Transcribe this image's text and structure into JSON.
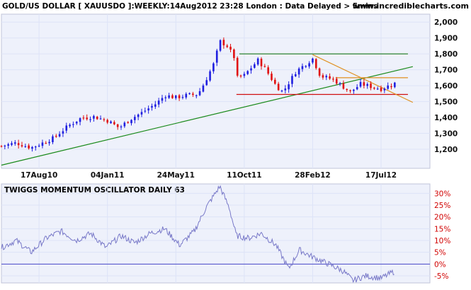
{
  "header": {
    "title": "GOLD/US DOLLAR [ XAUUSDO ]:WEEKLY:14Aug2012 23:28 London : Data Delayed > 5mins",
    "site": "www.incrediblecharts.com"
  },
  "colors": {
    "up_candle": "#1f1fe0",
    "down_candle": "#e01010",
    "support_trend": "#1a8a1a",
    "resistance_line": "#1a7a1a",
    "red_support": "#d01010",
    "orange_line": "#e09020",
    "oscillator_line": "#7878c8",
    "zero_line": "#4848c8",
    "grid": "#dde3f7",
    "background": "#eef1fb"
  },
  "chart_data": [
    {
      "type": "candlestick",
      "title": "",
      "xlabel": "",
      "ylabel": "",
      "x_ticks": [
        "17Aug10",
        "04Jan11",
        "24May11",
        "11Oct11",
        "28Feb12",
        "17Jul12"
      ],
      "y_ticks": [
        "1,200",
        "1,300",
        "1,400",
        "1,500",
        "1,600",
        "1,700",
        "1,800",
        "1,900",
        "2,000"
      ],
      "ylim": [
        1080,
        2050
      ],
      "grid": true,
      "close_points": [
        [
          "2010-06-01",
          1220
        ],
        [
          "2010-07-01",
          1240
        ],
        [
          "2010-08-01",
          1210
        ],
        [
          "2010-08-17",
          1230
        ],
        [
          "2010-09-15",
          1270
        ],
        [
          "2010-10-15",
          1345
        ],
        [
          "2010-11-10",
          1395
        ],
        [
          "2010-12-07",
          1405
        ],
        [
          "2011-01-04",
          1380
        ],
        [
          "2011-01-28",
          1335
        ],
        [
          "2011-02-20",
          1390
        ],
        [
          "2011-03-15",
          1430
        ],
        [
          "2011-04-15",
          1490
        ],
        [
          "2011-05-02",
          1540
        ],
        [
          "2011-05-24",
          1525
        ],
        [
          "2011-06-15",
          1540
        ],
        [
          "2011-07-08",
          1545
        ],
        [
          "2011-07-22",
          1620
        ],
        [
          "2011-08-10",
          1740
        ],
        [
          "2011-08-22",
          1880
        ],
        [
          "2011-09-06",
          1850
        ],
        [
          "2011-09-20",
          1780
        ],
        [
          "2011-09-27",
          1650
        ],
        [
          "2011-10-11",
          1665
        ],
        [
          "2011-11-08",
          1760
        ],
        [
          "2011-11-22",
          1710
        ],
        [
          "2011-12-15",
          1600
        ],
        [
          "2011-12-29",
          1560
        ],
        [
          "2012-01-25",
          1690
        ],
        [
          "2012-02-28",
          1770
        ],
        [
          "2012-03-15",
          1660
        ],
        [
          "2012-04-10",
          1640
        ],
        [
          "2012-05-15",
          1560
        ],
        [
          "2012-06-05",
          1610
        ],
        [
          "2012-07-17",
          1580
        ],
        [
          "2012-08-14",
          1615
        ]
      ],
      "annotations": [
        {
          "type": "trendline",
          "color": "support_trend",
          "from": [
            "2010-06-01",
            1100
          ],
          "to": [
            "2012-09-20",
            1720
          ]
        },
        {
          "type": "horizontal",
          "color": "resistance_line",
          "y": 1800,
          "from": "2011-10-01",
          "to": "2012-09-10"
        },
        {
          "type": "horizontal",
          "color": "red_support",
          "y": 1545,
          "from": "2011-09-25",
          "to": "2012-09-10"
        },
        {
          "type": "horizontal",
          "color": "orange_line",
          "y": 1650,
          "from": "2012-04-15",
          "to": "2012-09-10"
        },
        {
          "type": "trendline",
          "color": "orange_line",
          "from": [
            "2012-02-28",
            1795
          ],
          "to": [
            "2012-09-20",
            1495
          ]
        }
      ]
    },
    {
      "type": "line",
      "title": "TWIGGS MOMENTUM OSCILLATOR DAILY 63",
      "xlabel": "",
      "ylabel": "",
      "y_ticks": [
        "30%",
        "25%",
        "20%",
        "15%",
        "10%",
        "5%",
        "0%",
        "-5%"
      ],
      "ylim": [
        -8,
        34
      ],
      "zero_line": 0,
      "series": [
        {
          "name": "",
          "values": [
            [
              "2010-06-01",
              7
            ],
            [
              "2010-07-01",
              10
            ],
            [
              "2010-08-01",
              5
            ],
            [
              "2010-09-01",
              11
            ],
            [
              "2010-10-01",
              14
            ],
            [
              "2010-11-01",
              10
            ],
            [
              "2010-12-01",
              13
            ],
            [
              "2011-01-01",
              7
            ],
            [
              "2011-02-01",
              12
            ],
            [
              "2011-03-01",
              9
            ],
            [
              "2011-04-01",
              13
            ],
            [
              "2011-05-01",
              15
            ],
            [
              "2011-06-01",
              8
            ],
            [
              "2011-07-01",
              14
            ],
            [
              "2011-07-25",
              24
            ],
            [
              "2011-08-22",
              33
            ],
            [
              "2011-09-10",
              24
            ],
            [
              "2011-09-25",
              12
            ],
            [
              "2011-10-20",
              11
            ],
            [
              "2011-11-15",
              13
            ],
            [
              "2011-12-15",
              8
            ],
            [
              "2012-01-10",
              -2
            ],
            [
              "2012-02-01",
              6
            ],
            [
              "2012-02-28",
              3
            ],
            [
              "2012-04-01",
              0
            ],
            [
              "2012-05-01",
              -3
            ],
            [
              "2012-05-20",
              -7
            ],
            [
              "2012-06-15",
              -5
            ],
            [
              "2012-07-17",
              -6
            ],
            [
              "2012-08-14",
              -3
            ]
          ]
        }
      ]
    }
  ]
}
